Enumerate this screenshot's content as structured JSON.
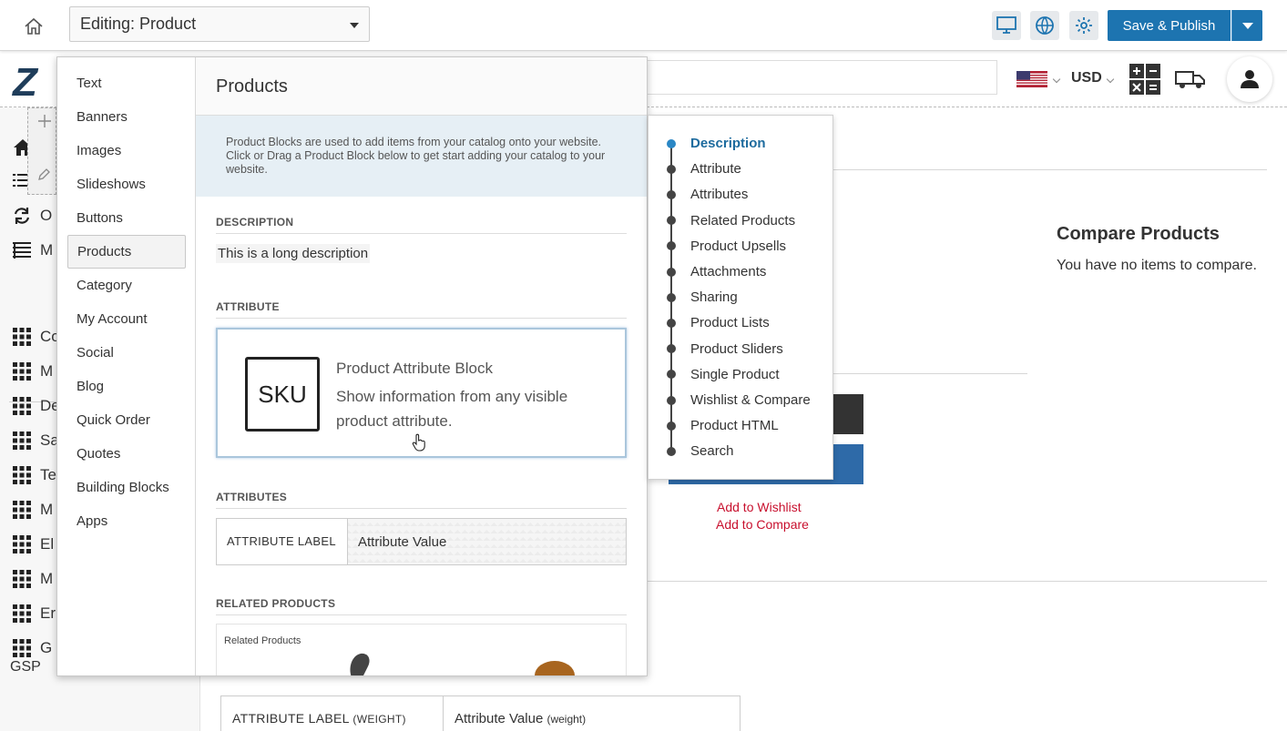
{
  "editor": {
    "editing_label": "Editing: Product",
    "save_label": "Save & Publish"
  },
  "site": {
    "currency": "USD",
    "nav_footer": "GSP",
    "nav_partial": [
      "H",
      "",
      "O",
      "M",
      "Co",
      "M",
      "De",
      "Sa",
      "Te",
      "M",
      "El",
      "M",
      "Er",
      "G"
    ],
    "compare_title": "Compare Products",
    "compare_text": "You have no items to compare.",
    "add_to_wishlist": "Add to Wishlist",
    "add_to_compare": "Add to Compare",
    "attr_label": "ATTRIBUTE LABEL",
    "attr_label_suffix": "(WEIGHT)",
    "attr_value": "Attribute Value",
    "attr_value_suffix": "(weight)"
  },
  "panel": {
    "categories": [
      {
        "label": "Text"
      },
      {
        "label": "Banners"
      },
      {
        "label": "Images"
      },
      {
        "label": "Slideshows"
      },
      {
        "label": "Buttons"
      },
      {
        "label": "Products",
        "active": true
      },
      {
        "label": "Category"
      },
      {
        "label": "My Account"
      },
      {
        "label": "Social"
      },
      {
        "label": "Blog"
      },
      {
        "label": "Quick Order"
      },
      {
        "label": "Quotes"
      },
      {
        "label": "Building Blocks"
      },
      {
        "label": "Apps"
      }
    ],
    "heading": "Products",
    "intro": "Product Blocks are used to add items from your catalog onto your website. Click or Drag a Product Block below to get start adding your catalog to your website.",
    "sections": {
      "description": "DESCRIPTION",
      "attribute": "ATTRIBUTE",
      "attributes": "ATTRIBUTES",
      "related": "RELATED PRODUCTS"
    },
    "description_sample": "This is a long description",
    "attribute_block": {
      "icon_text": "SKU",
      "title": "Product Attribute Block",
      "description": "Show information from any visible product attribute."
    },
    "attributes_sample": {
      "label": "ATTRIBUTE LABEL",
      "value": "Attribute Value"
    },
    "related_sample_title": "Related Products"
  },
  "index": {
    "items": [
      {
        "label": "Description",
        "active": true
      },
      {
        "label": "Attribute"
      },
      {
        "label": "Attributes"
      },
      {
        "label": "Related Products"
      },
      {
        "label": "Product Upsells"
      },
      {
        "label": "Attachments"
      },
      {
        "label": "Sharing"
      },
      {
        "label": "Product Lists"
      },
      {
        "label": "Product Sliders"
      },
      {
        "label": "Single Product"
      },
      {
        "label": "Wishlist & Compare"
      },
      {
        "label": "Product HTML"
      },
      {
        "label": "Search"
      }
    ]
  },
  "colors": {
    "accent": "#1d74b0",
    "link_red": "#c8102e",
    "intro_bg": "#e6eff5"
  }
}
